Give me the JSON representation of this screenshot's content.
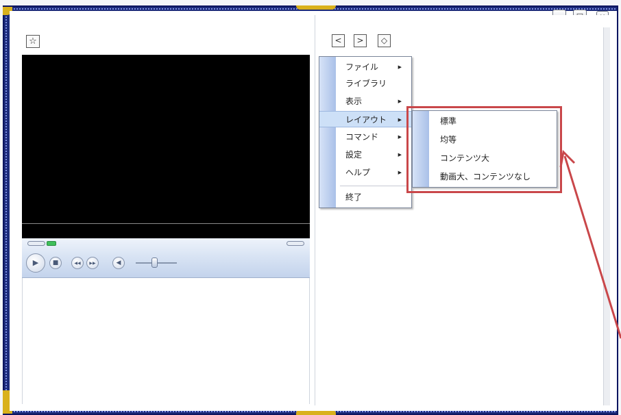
{
  "window": {
    "caption_buttons": {
      "minimize_icon": "_",
      "maximize_icon": "□",
      "close_icon": "×"
    }
  },
  "left_pane": {
    "favorite_icon": "☆",
    "player": {
      "play_icon": "▶",
      "stop_icon": "■",
      "prev_icon": "◀◀",
      "next_icon": "▶▶",
      "volume_icon": "◀",
      "volume_level": 0.45
    }
  },
  "right_pane": {
    "nav": {
      "back_icon": "<",
      "forward_icon": ">",
      "home_icon": "◇"
    }
  },
  "main_menu": {
    "items": [
      {
        "label": "ファイル",
        "has_submenu": true
      },
      {
        "label": "ライブラリ",
        "has_submenu": false
      },
      {
        "label": "表示",
        "has_submenu": true
      },
      {
        "label": "レイアウト",
        "has_submenu": true,
        "highlighted": true
      },
      {
        "label": "コマンド",
        "has_submenu": true
      },
      {
        "label": "設定",
        "has_submenu": true
      },
      {
        "label": "ヘルプ",
        "has_submenu": true
      },
      {
        "label": "終了",
        "has_submenu": false
      }
    ],
    "arrow_glyph": "▶"
  },
  "layout_submenu": {
    "items": [
      {
        "label": "標準"
      },
      {
        "label": "均等"
      },
      {
        "label": "コンテンツ大"
      },
      {
        "label": "動画大、コンテンツなし"
      }
    ]
  },
  "colors": {
    "frame_blue": "#1c2b7a",
    "frame_gold": "#d9b11c",
    "annotation_red": "#c9474a",
    "menu_highlight": "#cde0f7"
  }
}
